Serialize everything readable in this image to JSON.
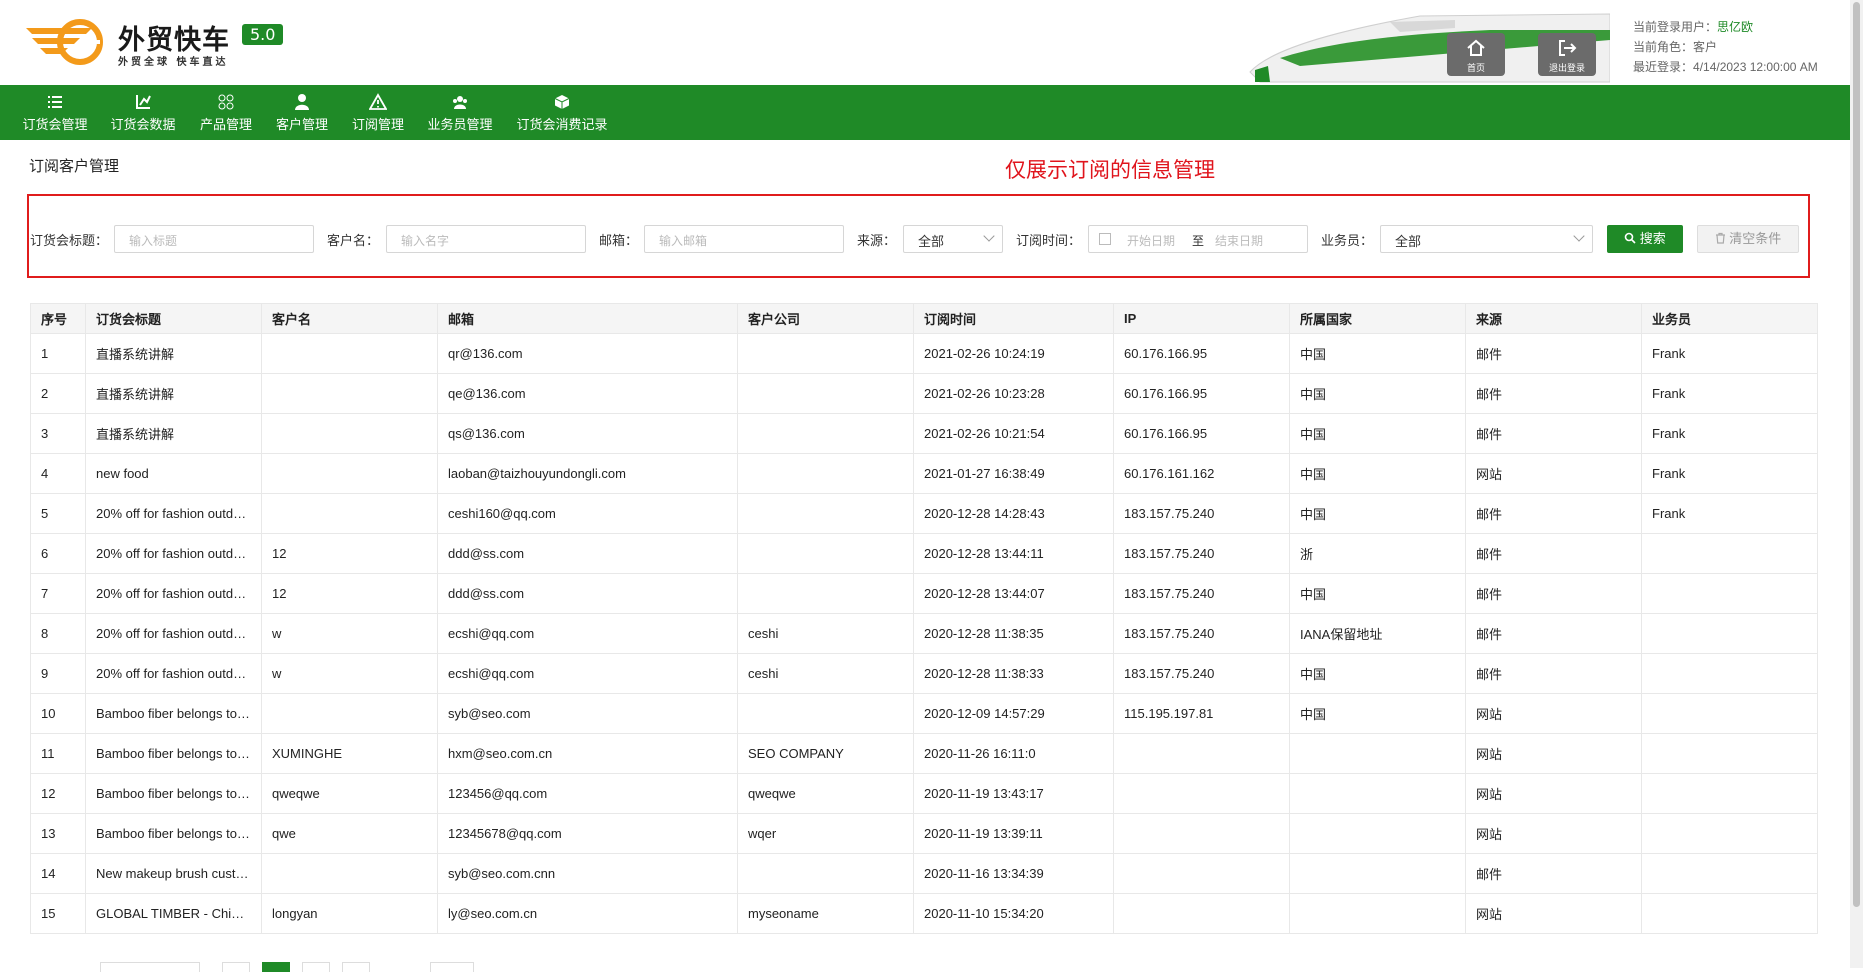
{
  "brand": {
    "name": "外贸快车",
    "version": "5.0",
    "slogan": "外贸全球 快车直达",
    "accent": "#1f8a27",
    "logo_color": "#f39a1a"
  },
  "header": {
    "home_label": "首页",
    "logout_label": "退出登录",
    "user_label": "当前登录用户：",
    "user_name": "思亿欧",
    "role_label": "当前角色：",
    "role_value": "客户",
    "last_login_label": "最近登录：",
    "last_login_value": "4/14/2023 12:00:00 AM"
  },
  "nav": [
    {
      "label": "订货会管理",
      "icon": "list-icon"
    },
    {
      "label": "订货会数据",
      "icon": "chart-icon"
    },
    {
      "label": "产品管理",
      "icon": "grid-icon"
    },
    {
      "label": "客户管理",
      "icon": "user-icon"
    },
    {
      "label": "订阅管理",
      "icon": "warning-icon"
    },
    {
      "label": "业务员管理",
      "icon": "group-icon"
    },
    {
      "label": "订货会消费记录",
      "icon": "cube-icon"
    }
  ],
  "page": {
    "title": "订阅客户管理",
    "annotation": "仅展示订阅的信息管理"
  },
  "filters": {
    "title_label": "订货会标题：",
    "title_placeholder": "输入标题",
    "customer_label": "客户名：",
    "customer_placeholder": "输入名字",
    "email_label": "邮箱：",
    "email_placeholder": "输入邮箱",
    "source_label": "来源：",
    "source_value": "全部",
    "time_label": "订阅时间：",
    "date_start": "开始日期",
    "date_to": "至",
    "date_end": "结束日期",
    "salesman_label": "业务员：",
    "salesman_value": "全部",
    "search_label": "搜索",
    "clear_label": "清空条件"
  },
  "table": {
    "columns": [
      "序号",
      "订货会标题",
      "客户名",
      "邮箱",
      "客户公司",
      "订阅时间",
      "IP",
      "所属国家",
      "来源",
      "业务员"
    ],
    "rows": [
      [
        "1",
        "直播系统讲解",
        "",
        "qr@136.com",
        "",
        "2021-02-26 10:24:19",
        "60.176.166.95",
        "中国",
        "邮件",
        "Frank"
      ],
      [
        "2",
        "直播系统讲解",
        "",
        "qe@136.com",
        "",
        "2021-02-26 10:23:28",
        "60.176.166.95",
        "中国",
        "邮件",
        "Frank"
      ],
      [
        "3",
        "直播系统讲解",
        "",
        "qs@136.com",
        "",
        "2021-02-26 10:21:54",
        "60.176.166.95",
        "中国",
        "邮件",
        "Frank"
      ],
      [
        "4",
        "new food",
        "",
        "laoban@taizhouyundongli.com",
        "",
        "2021-01-27 16:38:49",
        "60.176.161.162",
        "中国",
        "网站",
        "Frank"
      ],
      [
        "5",
        "20% off for fashion outd…",
        "",
        "ceshi160@qq.com",
        "",
        "2020-12-28 14:28:43",
        "183.157.75.240",
        "中国",
        "邮件",
        "Frank"
      ],
      [
        "6",
        "20% off for fashion outd…",
        "12",
        "ddd@ss.com",
        "",
        "2020-12-28 13:44:11",
        "183.157.75.240",
        "浙",
        "邮件",
        ""
      ],
      [
        "7",
        "20% off for fashion outd…",
        "12",
        "ddd@ss.com",
        "",
        "2020-12-28 13:44:07",
        "183.157.75.240",
        "中国",
        "邮件",
        ""
      ],
      [
        "8",
        "20% off for fashion outd…",
        "w",
        "ecshi@qq.com",
        "ceshi",
        "2020-12-28 11:38:35",
        "183.157.75.240",
        "IANA保留地址",
        "邮件",
        ""
      ],
      [
        "9",
        "20% off for fashion outd…",
        "w",
        "ecshi@qq.com",
        "ceshi",
        "2020-12-28 11:38:33",
        "183.157.75.240",
        "中国",
        "邮件",
        ""
      ],
      [
        "10",
        "Bamboo fiber belongs to…",
        "",
        "syb@seo.com",
        "",
        "2020-12-09 14:57:29",
        "115.195.197.81",
        "中国",
        "网站",
        ""
      ],
      [
        "11",
        "Bamboo fiber belongs to…",
        "XUMINGHE",
        "hxm@seo.com.cn",
        "SEO COMPANY",
        "2020-11-26 16:11:0",
        "",
        "",
        "网站",
        ""
      ],
      [
        "12",
        "Bamboo fiber belongs to…",
        "qweqwe",
        "123456@qq.com",
        "qweqwe",
        "2020-11-19 13:43:17",
        "",
        "",
        "网站",
        ""
      ],
      [
        "13",
        "Bamboo fiber belongs to…",
        "qwe",
        "12345678@qq.com",
        "wqer",
        "2020-11-19 13:39:11",
        "",
        "",
        "网站",
        ""
      ],
      [
        "14",
        "New makeup brush cust…",
        "",
        "syb@seo.com.cnn",
        "",
        "2020-11-16 13:34:39",
        "",
        "",
        "邮件",
        ""
      ],
      [
        "15",
        "GLOBAL TIMBER - Chi…",
        "longyan",
        "ly@seo.com.cn",
        "myseoname",
        "2020-11-10 15:34:20",
        "",
        "",
        "网站",
        ""
      ]
    ]
  }
}
